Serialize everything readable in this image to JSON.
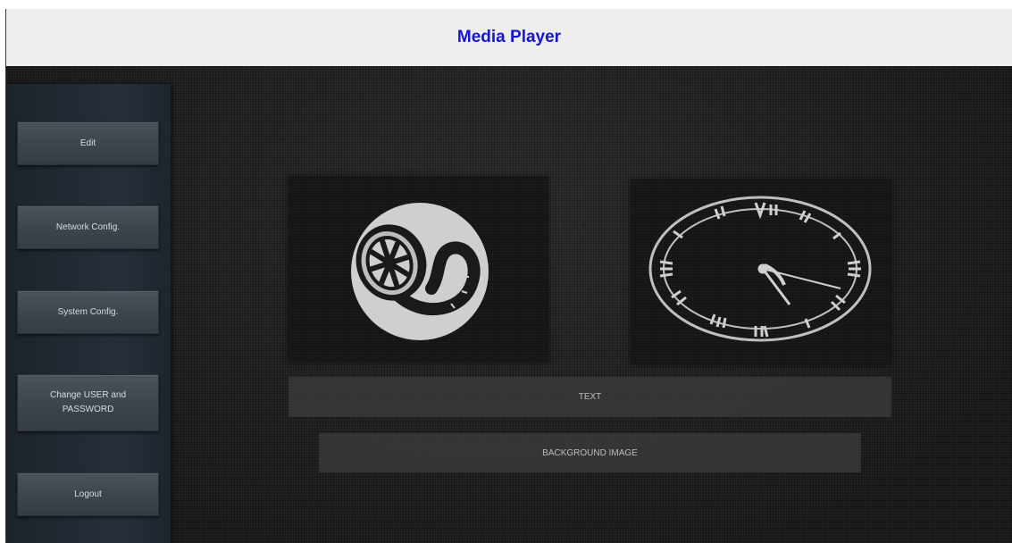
{
  "header": {
    "title": "Media Player",
    "title_color": "#1515d6"
  },
  "sidebar": {
    "items": [
      {
        "label": "Edit"
      },
      {
        "label": "Network Config."
      },
      {
        "label": "System Config."
      },
      {
        "label": "Change USER and\nPASSWORD"
      },
      {
        "label": "Logout"
      }
    ]
  },
  "main": {
    "tiles": [
      {
        "icon": "film-reel-icon"
      },
      {
        "icon": "clock-icon"
      }
    ],
    "text_button": {
      "label": "TEXT"
    },
    "background_button": {
      "label": "BACKGROUND IMAGE"
    }
  },
  "colors": {
    "accent": "#1515d6",
    "panel_dark": "#1f1f1f",
    "sidebar": "#26303a"
  }
}
